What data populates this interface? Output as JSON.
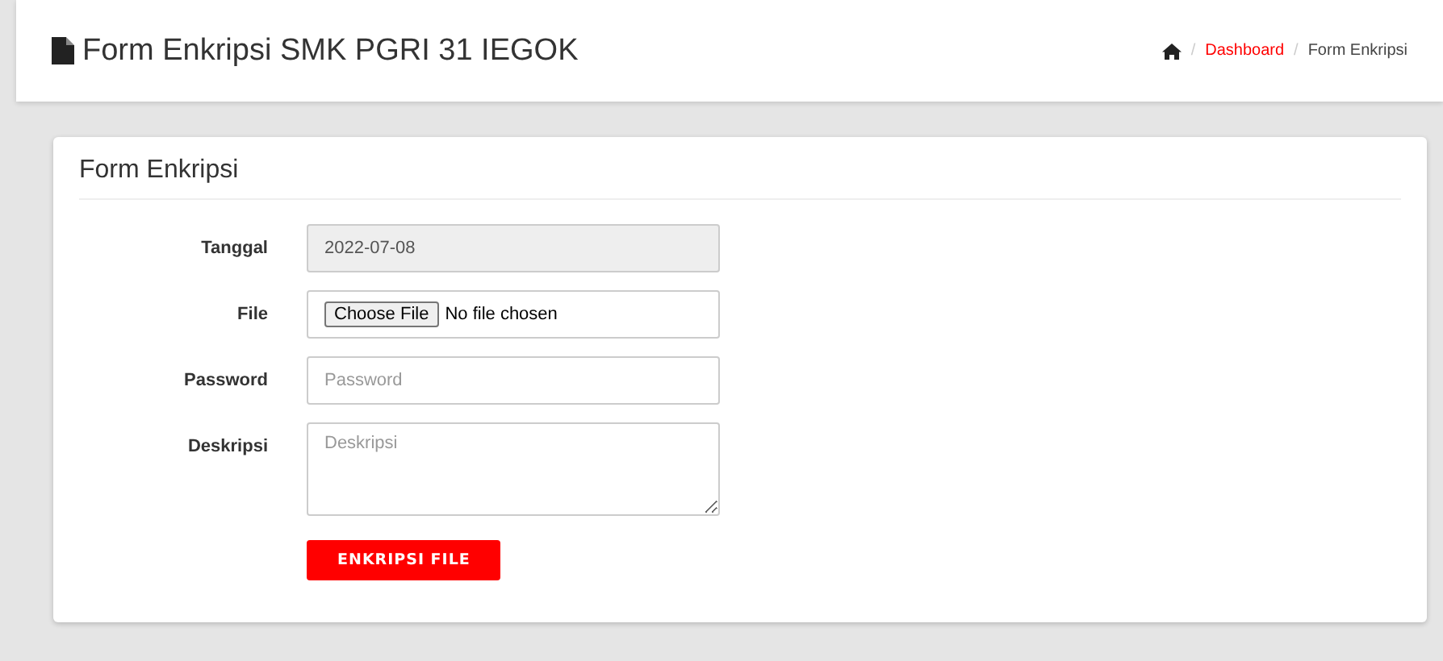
{
  "header": {
    "title": "Form Enkripsi SMK PGRI 31 IEGOK",
    "breadcrumb": [
      {
        "separator": "/",
        "label": "Dashboard",
        "kind": "link"
      },
      {
        "separator": "/",
        "label": "Form Enkripsi",
        "kind": "current"
      }
    ]
  },
  "card": {
    "title": "Form Enkripsi",
    "fields": [
      {
        "label": "Tanggal",
        "kind": "text",
        "value": "2022-07-08",
        "disabled": true
      },
      {
        "label": "File",
        "kind": "file",
        "button": "Choose File",
        "status": "No file chosen",
        "disabled": false
      },
      {
        "label": "Password",
        "kind": "password",
        "placeholder": "Password",
        "disabled": false
      },
      {
        "label": "Deskripsi",
        "kind": "textarea",
        "placeholder": "Deskripsi",
        "disabled": false
      }
    ],
    "submit": "ENKRIPSI FILE"
  }
}
